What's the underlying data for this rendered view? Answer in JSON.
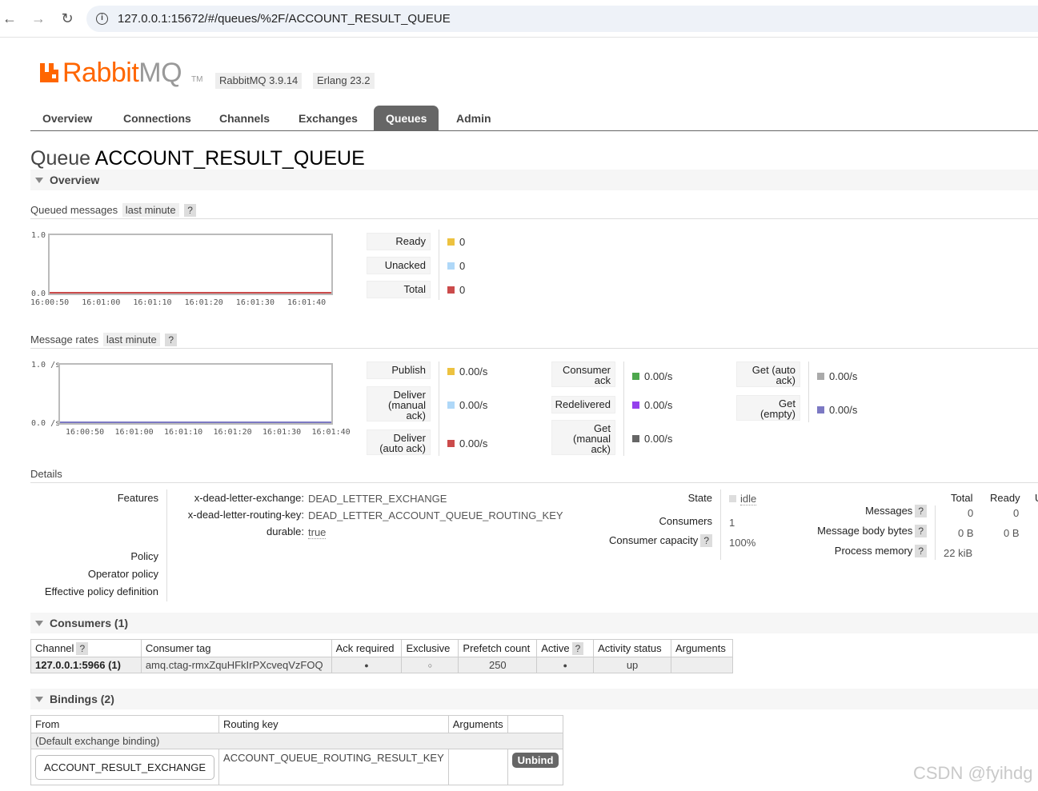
{
  "browser": {
    "back_icon": "←",
    "forward_icon": "→",
    "reload_icon": "↻",
    "url": "127.0.0.1:15672/#/queues/%2F/ACCOUNT_RESULT_QUEUE"
  },
  "header": {
    "logo_rabbit": "Rabbit",
    "logo_mq": "MQ",
    "logo_tm": "TM",
    "version": "RabbitMQ 3.9.14",
    "erlang": "Erlang 23.2"
  },
  "tabs": [
    "Overview",
    "Connections",
    "Channels",
    "Exchanges",
    "Queues",
    "Admin"
  ],
  "page": {
    "title_prefix": "Queue",
    "title_name": "ACCOUNT_RESULT_QUEUE"
  },
  "overview": {
    "label": "Overview"
  },
  "queued": {
    "label": "Queued messages",
    "range": "last minute",
    "help": "?",
    "y_max": "1.0",
    "y_min": "0.0",
    "x_ticks": [
      "16:00:50",
      "16:01:00",
      "16:01:10",
      "16:01:20",
      "16:01:30",
      "16:01:40"
    ],
    "legend": [
      {
        "label": "Ready",
        "value": "0",
        "color": "#edc240"
      },
      {
        "label": "Unacked",
        "value": "0",
        "color": "#afd8f8"
      },
      {
        "label": "Total",
        "value": "0",
        "color": "#cb4b4b"
      }
    ]
  },
  "rates": {
    "label": "Message rates",
    "range": "last minute",
    "help": "?",
    "y_max": "1.0 /s",
    "y_min": "0.0 /s",
    "x_ticks": [
      "16:00:50",
      "16:01:00",
      "16:01:10",
      "16:01:20",
      "16:01:30",
      "16:01:40"
    ],
    "col1": [
      {
        "label": "Publish",
        "value": "0.00/s",
        "color": "#edc240"
      },
      {
        "label": "Deliver\n(manual\nack)",
        "value": "0.00/s",
        "color": "#afd8f8"
      },
      {
        "label": "Deliver\n(auto ack)",
        "value": "0.00/s",
        "color": "#cb4b4b"
      }
    ],
    "col2": [
      {
        "label": "Consumer\nack",
        "value": "0.00/s",
        "color": "#4da74d"
      },
      {
        "label": "Redelivered",
        "value": "0.00/s",
        "color": "#9440ed"
      },
      {
        "label": "Get\n(manual\nack)",
        "value": "0.00/s",
        "color": "#666666"
      }
    ],
    "col3": [
      {
        "label": "Get (auto\nack)",
        "value": "0.00/s",
        "color": "#aaaaaa"
      },
      {
        "label": "Get\n(empty)",
        "value": "0.00/s",
        "color": "#7c79c3"
      }
    ]
  },
  "details": {
    "label": "Details",
    "features_label": "Features",
    "features": [
      {
        "key": "x-dead-letter-exchange:",
        "value": "DEAD_LETTER_EXCHANGE"
      },
      {
        "key": "x-dead-letter-routing-key:",
        "value": "DEAD_LETTER_ACCOUNT_QUEUE_ROUTING_KEY"
      },
      {
        "key": "durable:",
        "value": "true"
      }
    ],
    "policy_label": "Policy",
    "operator_policy_label": "Operator policy",
    "effective_policy_label": "Effective policy definition",
    "state_label": "State",
    "state_value": "idle",
    "consumers_label": "Consumers",
    "consumers_value": "1",
    "capacity_label": "Consumer capacity",
    "capacity_value": "100%",
    "help": "?",
    "totals_header": {
      "total": "Total",
      "ready": "Ready",
      "more": "U"
    },
    "messages_label": "Messages",
    "messages_total": "0",
    "messages_ready": "0",
    "body_bytes_label": "Message body bytes",
    "body_bytes_total": "0 B",
    "body_bytes_ready": "0 B",
    "memory_label": "Process memory",
    "memory_total": "22 kiB"
  },
  "consumers": {
    "label": "Consumers (1)",
    "headers": [
      "Channel",
      "Consumer tag",
      "Ack required",
      "Exclusive",
      "Prefetch count",
      "Active",
      "Activity status",
      "Arguments"
    ],
    "help": "?",
    "row": {
      "channel": "127.0.0.1:5966 (1)",
      "tag": "amq.ctag-rmxZquHFkIrPXcveqVzFOQ",
      "ack": "●",
      "exclusive": "○",
      "prefetch": "250",
      "active": "●",
      "status": "up",
      "arguments": ""
    }
  },
  "bindings": {
    "label": "Bindings (2)",
    "headers": [
      "From",
      "Routing key",
      "Arguments"
    ],
    "default_row": "(Default exchange binding)",
    "row": {
      "from": "ACCOUNT_RESULT_EXCHANGE",
      "routing_key": "ACCOUNT_QUEUE_ROUTING_RESULT_KEY",
      "arguments": "",
      "unbind": "Unbind"
    }
  },
  "watermark": "CSDN @fyihdg"
}
